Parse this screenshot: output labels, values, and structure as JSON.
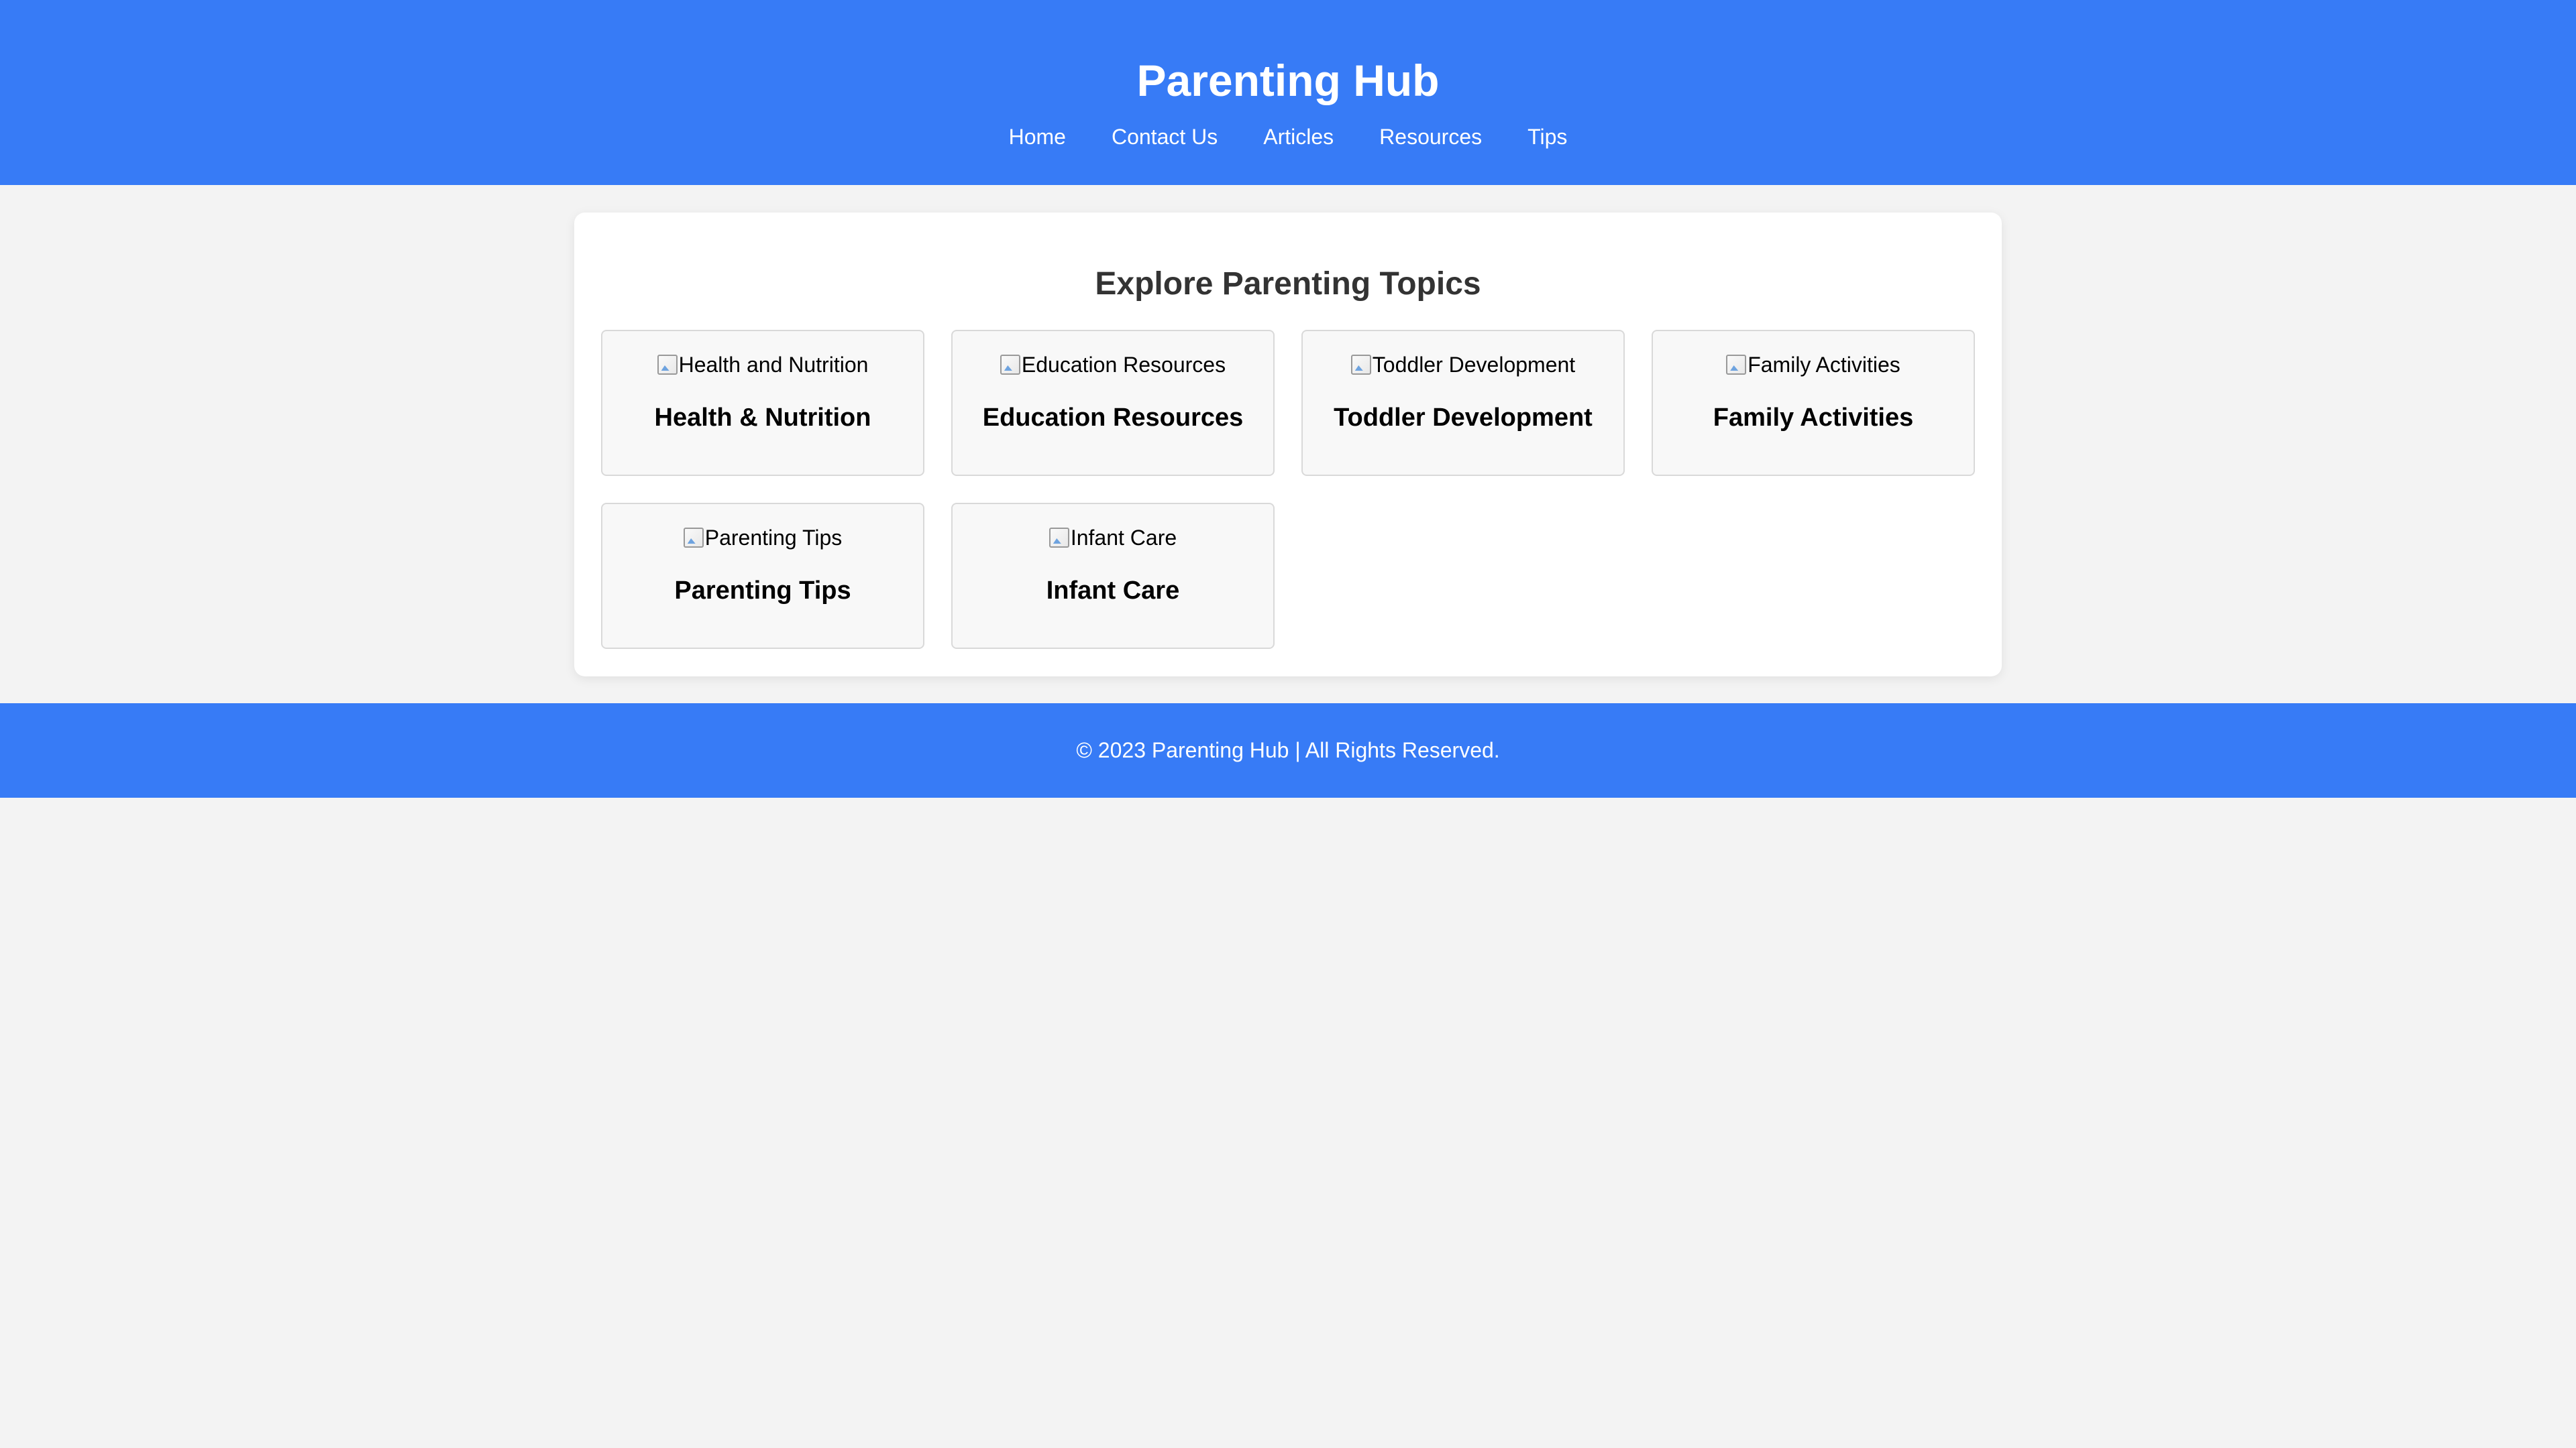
{
  "header": {
    "title": "Parenting Hub",
    "nav": [
      "Home",
      "Contact Us",
      "Articles",
      "Resources",
      "Tips"
    ]
  },
  "main": {
    "section_title": "Explore Parenting Topics",
    "cards": [
      {
        "image_alt": "Health and Nutrition",
        "title": "Health & Nutrition"
      },
      {
        "image_alt": "Education Resources",
        "title": "Education Resources"
      },
      {
        "image_alt": "Toddler Development",
        "title": "Toddler Development"
      },
      {
        "image_alt": "Family Activities",
        "title": "Family Activities"
      },
      {
        "image_alt": "Parenting Tips",
        "title": "Parenting Tips"
      },
      {
        "image_alt": "Infant Care",
        "title": "Infant Care"
      }
    ]
  },
  "footer": {
    "text": "© 2023 Parenting Hub | All Rights Reserved."
  },
  "colors": {
    "primary": "#377bf6",
    "background": "#f3f3f3",
    "card_background": "#f8f8f8",
    "section_title": "#333333"
  },
  "icons": {
    "card_image": "broken-image-icon"
  }
}
